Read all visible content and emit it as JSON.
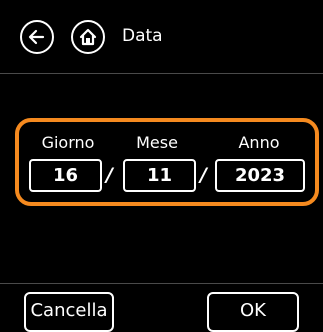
{
  "header": {
    "title": "Data",
    "back_icon": "back-arrow-icon",
    "home_icon": "home-icon"
  },
  "date": {
    "day_label": "Giorno",
    "month_label": "Mese",
    "year_label": "Anno",
    "day": "16",
    "month": "11",
    "year": "2023",
    "separator": "/"
  },
  "footer": {
    "cancel_label": "Cancella",
    "ok_label": "OK"
  },
  "colors": {
    "accent": "#f58a1f",
    "background": "#000000",
    "foreground": "#ffffff"
  }
}
